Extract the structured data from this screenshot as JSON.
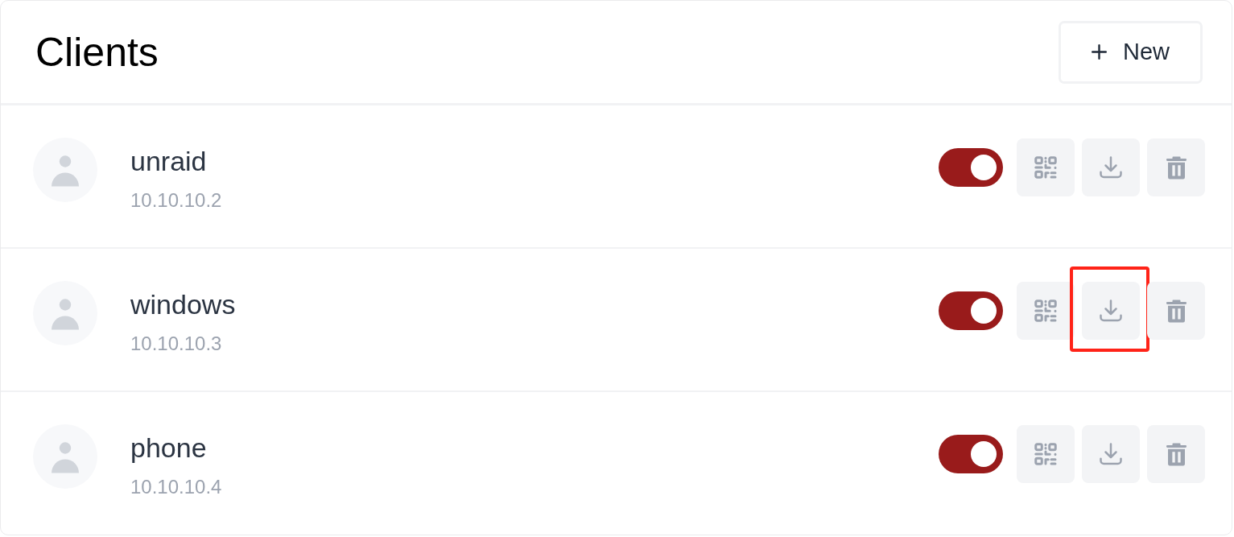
{
  "header": {
    "title": "Clients",
    "new_button": {
      "label": "New"
    }
  },
  "clients": [
    {
      "name": "unraid",
      "address": "10.10.10.2",
      "enabled": true,
      "actions": [
        {
          "kind": "qr",
          "highlighted": false
        },
        {
          "kind": "download",
          "highlighted": false
        },
        {
          "kind": "delete",
          "highlighted": false
        }
      ]
    },
    {
      "name": "windows",
      "address": "10.10.10.3",
      "enabled": true,
      "actions": [
        {
          "kind": "qr",
          "highlighted": false
        },
        {
          "kind": "download",
          "highlighted": true
        },
        {
          "kind": "delete",
          "highlighted": false
        }
      ]
    },
    {
      "name": "phone",
      "address": "10.10.10.4",
      "enabled": true,
      "actions": [
        {
          "kind": "qr",
          "highlighted": false
        },
        {
          "kind": "download",
          "highlighted": false
        },
        {
          "kind": "delete",
          "highlighted": false
        }
      ]
    }
  ]
}
